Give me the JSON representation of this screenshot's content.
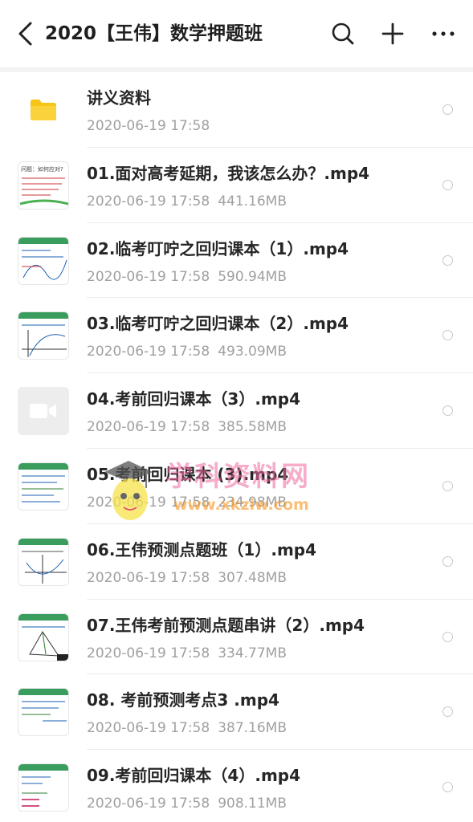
{
  "header": {
    "title": "2020【王伟】数学押题班",
    "back_icon": "back-arrow-icon",
    "search_icon": "search-icon",
    "add_icon": "plus-icon",
    "more_icon": "more-dots-icon"
  },
  "files": [
    {
      "name": "讲义资料",
      "date": "2020-06-19  17:58",
      "size": "",
      "thumb": "folder"
    },
    {
      "name": "01.面对高考延期，我该怎么办？.mp4",
      "date": "2020-06-19  17:58",
      "size": "441.16MB",
      "thumb": "slide"
    },
    {
      "name": "02.临考叮咛之回归课本（1）.mp4",
      "date": "2020-06-19  17:58",
      "size": "590.94MB",
      "thumb": "slide"
    },
    {
      "name": "03.临考叮咛之回归课本（2）.mp4",
      "date": "2020-06-19  17:58",
      "size": "493.09MB",
      "thumb": "slide"
    },
    {
      "name": "04.考前回归课本（3）.mp4",
      "date": "2020-06-19  17:58",
      "size": "385.58MB",
      "thumb": "video"
    },
    {
      "name": "05.考前回归课本 (3).mp4",
      "date": "2020-06-19  17:58",
      "size": "234.98MB",
      "thumb": "slide"
    },
    {
      "name": "06.王伟预测点题班（1）.mp4",
      "date": "2020-06-19  17:58",
      "size": "307.48MB",
      "thumb": "slide"
    },
    {
      "name": "07.王伟考前预测点题串讲（2）.mp4",
      "date": "2020-06-19  17:58",
      "size": "334.77MB",
      "thumb": "slide"
    },
    {
      "name": "08. 考前预测考点3 .mp4",
      "date": "2020-06-19  17:58",
      "size": "387.16MB",
      "thumb": "slide"
    },
    {
      "name": "09.考前回归课本（4）.mp4",
      "date": "2020-06-19  17:58",
      "size": "908.11MB",
      "thumb": "slide"
    }
  ],
  "watermark": {
    "text_cn": "学科资料网",
    "text_url": "www.xkziw.com"
  },
  "colors": {
    "folder": "#f5c518",
    "title": "#1f1f1f",
    "meta": "#a0a0a0",
    "divider": "#ececec",
    "watermark_pink": "#f06aa0",
    "watermark_orange": "#f7941d"
  }
}
